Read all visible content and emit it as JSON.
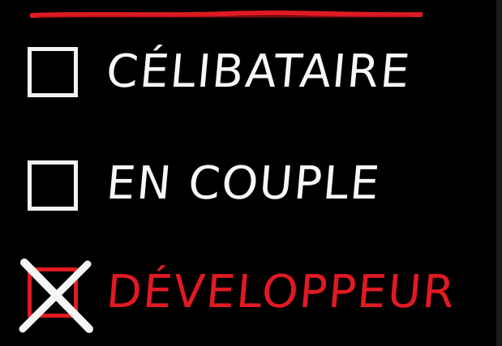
{
  "colors": {
    "background": "#000000",
    "chalk_white": "#f2f2f2",
    "chalk_red": "#e01a22"
  },
  "options": [
    {
      "label": "CÉLIBATAIRE",
      "checked": false
    },
    {
      "label": "EN COUPLE",
      "checked": false
    },
    {
      "label": "DÉVELOPPEUR",
      "checked": true
    }
  ]
}
